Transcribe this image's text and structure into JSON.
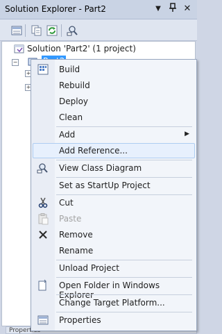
{
  "window": {
    "title": "Solution Explorer - Part2",
    "dropdown_glyph": "▼",
    "pin_glyph": "ꟷ",
    "close_glyph": "✕"
  },
  "toolbar": {
    "buttons": [
      "properties-icon",
      "show-all-files-icon",
      "refresh-icon",
      "view-class-diagram-icon"
    ]
  },
  "tree": {
    "solution_label": "Solution 'Part2' (1 project)",
    "project_label": "Part2"
  },
  "bottom_tab": {
    "label": "Properties"
  },
  "context_menu": {
    "build": "Build",
    "rebuild": "Rebuild",
    "deploy": "Deploy",
    "clean": "Clean",
    "add": "Add",
    "add_reference": "Add Reference...",
    "view_class_diagram": "View Class Diagram",
    "set_startup": "Set as StartUp Project",
    "cut": "Cut",
    "paste": "Paste",
    "remove": "Remove",
    "rename": "Rename",
    "unload_project": "Unload Project",
    "open_folder": "Open Folder in Windows Explorer",
    "change_target": "Change Target Platform...",
    "properties": "Properties"
  },
  "colors": {
    "selection": "#3399ff",
    "highlight_fill": "#e7f0fd",
    "highlight_border": "#aecdf2"
  }
}
